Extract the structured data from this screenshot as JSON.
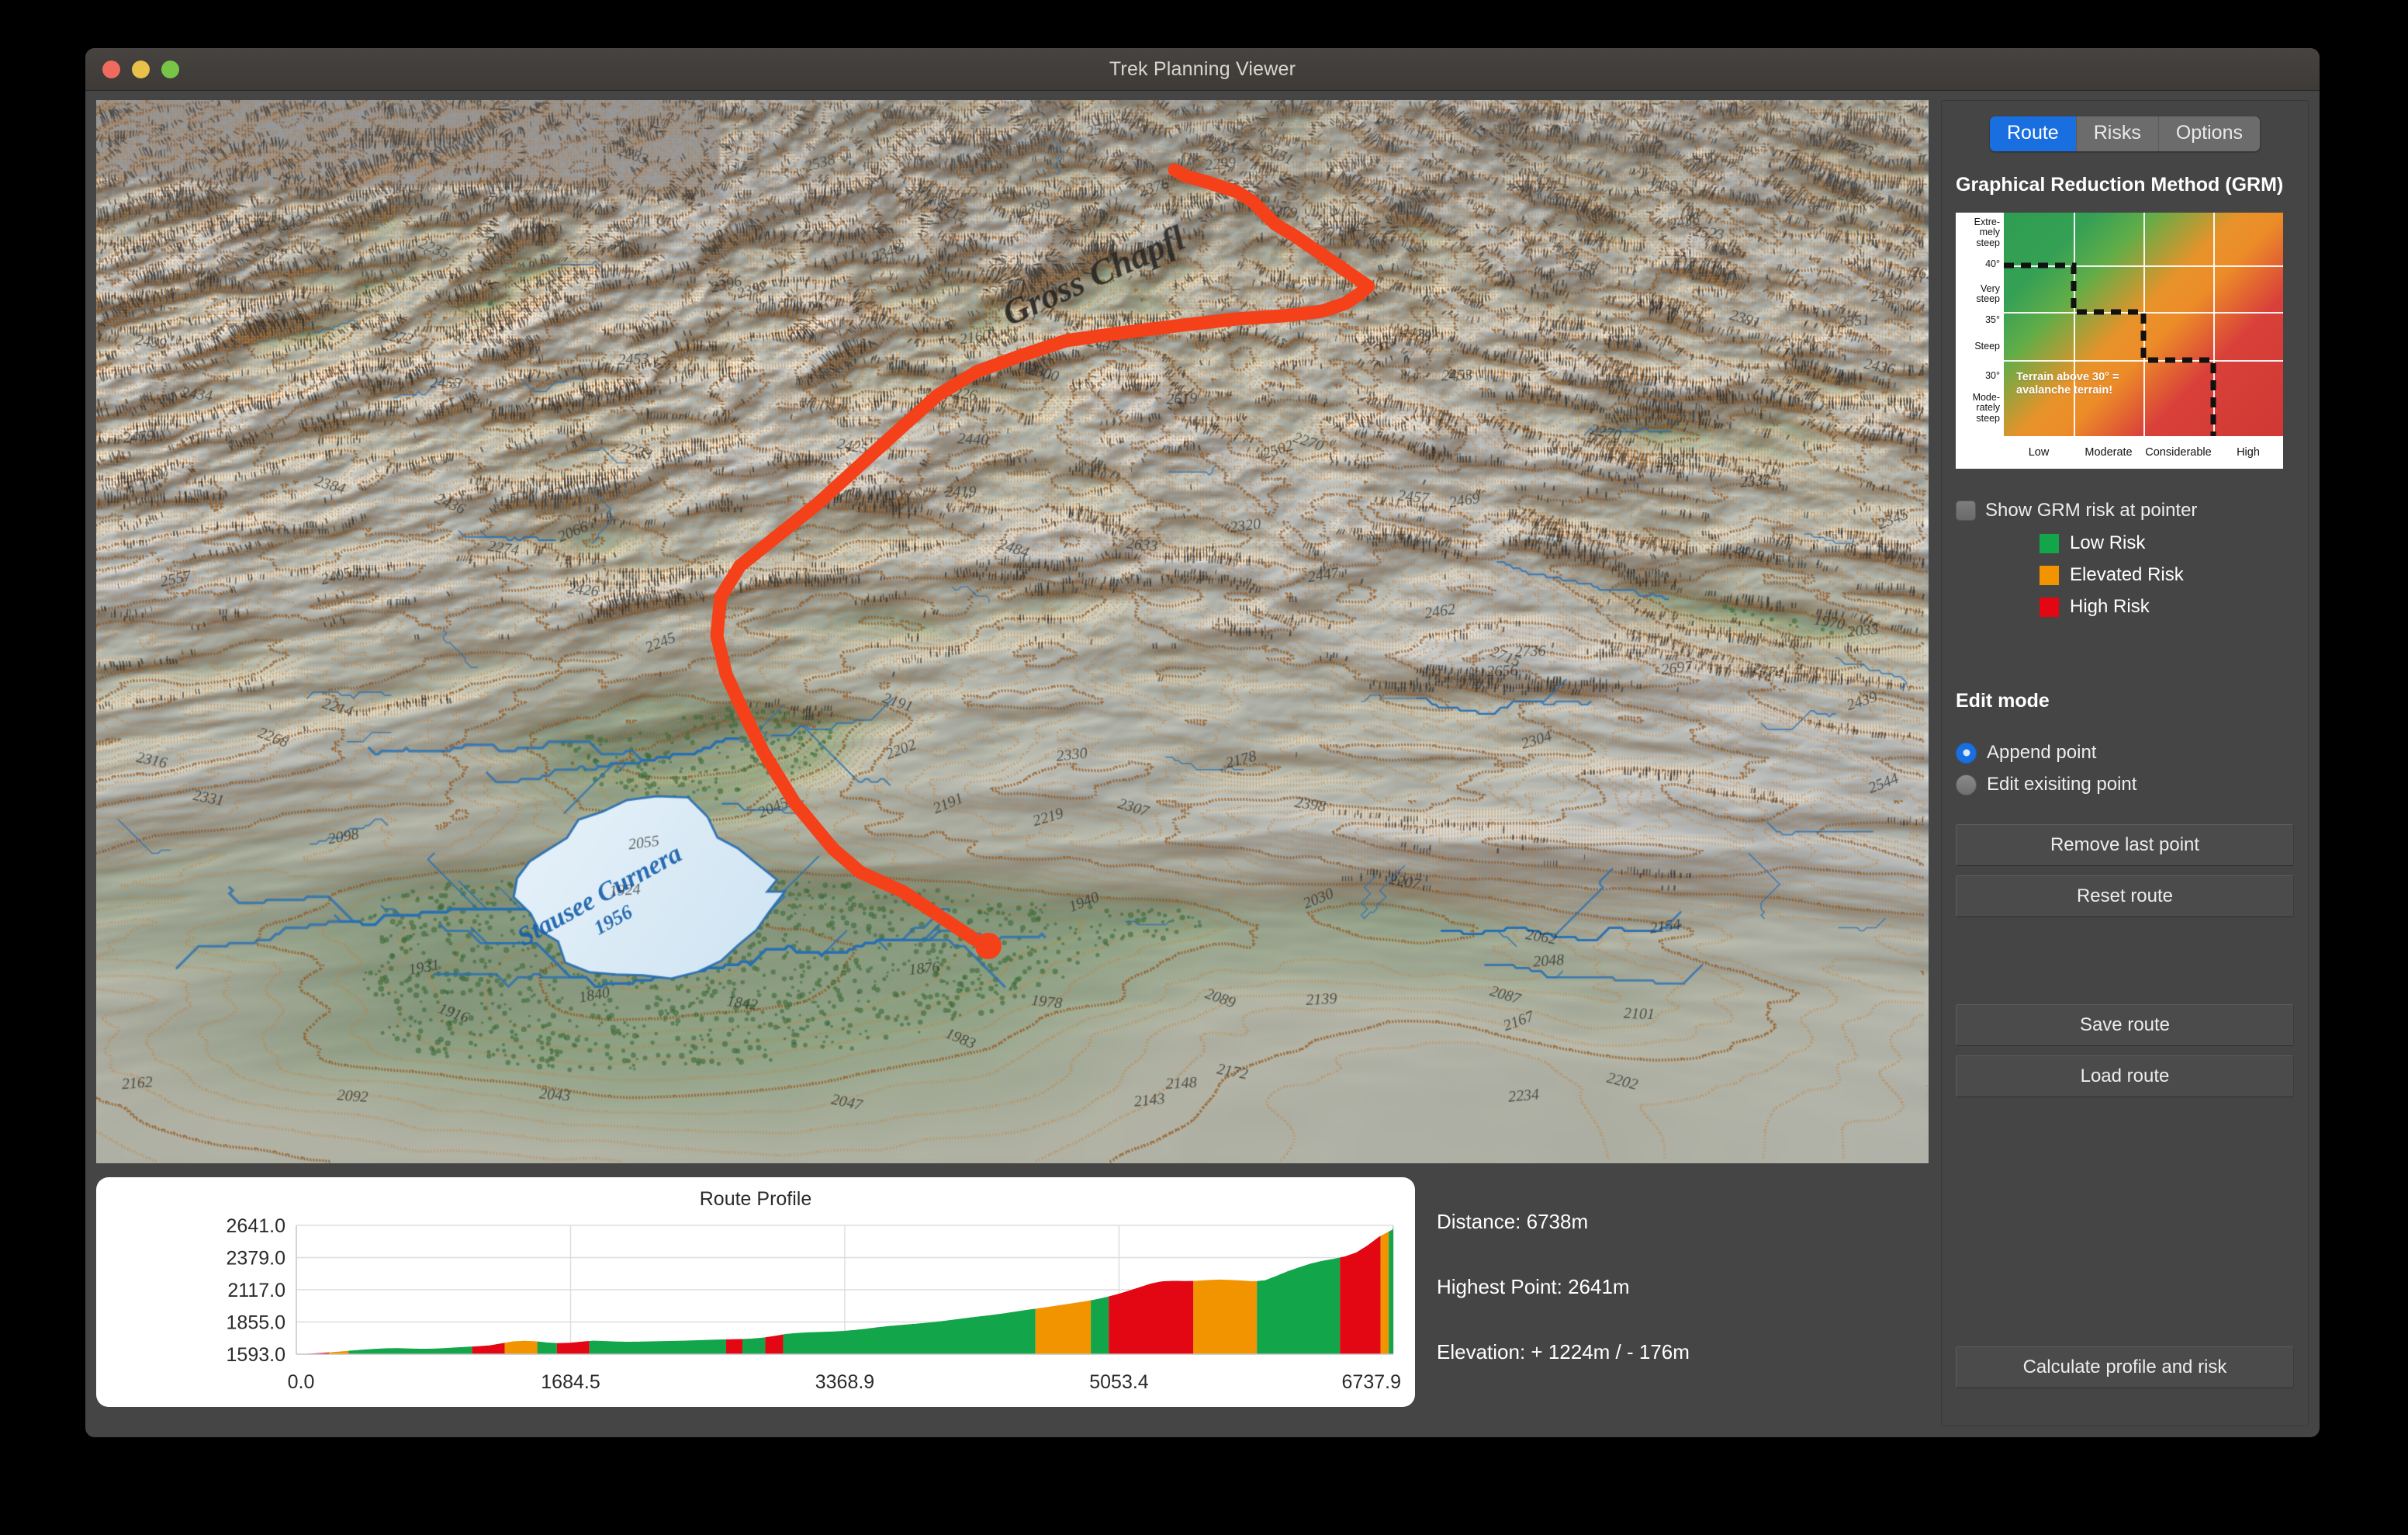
{
  "window": {
    "title": "Trek Planning Viewer",
    "traffic_lights": [
      "close",
      "minimize",
      "maximize"
    ]
  },
  "sidebar": {
    "tabs": [
      {
        "label": "Route",
        "active": true
      },
      {
        "label": "Risks",
        "active": false
      },
      {
        "label": "Options",
        "active": false
      }
    ],
    "grm_heading": "Graphical Reduction Method (GRM)",
    "grm_chart": {
      "y_labels": [
        "Extre-\nmely\nsteep",
        "40°",
        "Very\nsteep",
        "35°",
        "Steep",
        "30°",
        "Mode-\nrately\nsteep"
      ],
      "x_labels": [
        "Low",
        "Moderate",
        "Considerable",
        "High"
      ],
      "note": "Terrain above 30° =\navalanche terrain!"
    },
    "pointer_toggle": {
      "label": "Show GRM risk at pointer",
      "checked": false
    },
    "risk_legend": [
      {
        "label": "Low Risk",
        "color": "#13a54a"
      },
      {
        "label": "Elevated Risk",
        "color": "#f29400"
      },
      {
        "label": "High Risk",
        "color": "#e30613"
      }
    ],
    "edit_mode": {
      "heading": "Edit mode",
      "options": [
        {
          "label": "Append point",
          "selected": true
        },
        {
          "label": "Edit exisiting point",
          "selected": false
        }
      ]
    },
    "buttons": {
      "remove_last_point": "Remove last point",
      "reset_route": "Reset route",
      "save_route": "Save route",
      "load_route": "Load route",
      "calculate": "Calculate profile and risk"
    }
  },
  "map": {
    "background_color": "#9b9b9b",
    "route_color": "#f5411a",
    "visible_labels": [
      "Gross Chapfl",
      "Stausee Curnera 1956"
    ]
  },
  "stats": {
    "distance": "Distance: 6738m",
    "highest_point": "Highest Point:  2641m",
    "elevation": "Elevation: + 1224m / - 176m"
  },
  "chart_data": {
    "type": "area",
    "title": "Route Profile",
    "xlabel": "",
    "ylabel": "",
    "xlim": [
      0.0,
      6737.9
    ],
    "ylim": [
      1593.0,
      2641.0
    ],
    "grid": true,
    "legend": "none",
    "x_ticks": [
      0.0,
      1684.5,
      3368.9,
      5053.4,
      6737.9
    ],
    "x_tick_labels": [
      "0.0",
      "1684.5",
      "3368.9",
      "5053.4",
      "6737.9"
    ],
    "y_ticks": [
      1593.0,
      1855.0,
      2117.0,
      2379.0,
      2641.0
    ],
    "y_tick_labels": [
      "1593.0",
      "1855.0",
      "2117.0",
      "2379.0",
      "2641.0"
    ],
    "risk_colors": {
      "low": "#13a54a",
      "elevated": "#f29400",
      "high": "#e30613"
    },
    "x": [
      0,
      70,
      140,
      210,
      280,
      350,
      420,
      490,
      560,
      630,
      700,
      770,
      840,
      910,
      980,
      1050,
      1120,
      1190,
      1260,
      1330,
      1400,
      1470,
      1540,
      1610,
      1680,
      1750,
      1820,
      1890,
      1960,
      2030,
      2100,
      2170,
      2240,
      2310,
      2380,
      2450,
      2520,
      2590,
      2660,
      2730,
      2800,
      2870,
      2940,
      3010,
      3080,
      3150,
      3220,
      3290,
      3360,
      3430,
      3500,
      3570,
      3640,
      3710,
      3780,
      3850,
      3920,
      3990,
      4060,
      4130,
      4200,
      4270,
      4340,
      4410,
      4480,
      4550,
      4620,
      4690,
      4760,
      4830,
      4900,
      4970,
      5040,
      5110,
      5180,
      5250,
      5320,
      5390,
      5460,
      5530,
      5600,
      5670,
      5740,
      5810,
      5880,
      5950,
      6020,
      6090,
      6160,
      6230,
      6300,
      6370,
      6440,
      6510,
      6580,
      6650,
      6737.9
    ],
    "elevation": [
      1593,
      1597,
      1602,
      1608,
      1616,
      1624,
      1631,
      1637,
      1641,
      1642,
      1639,
      1637,
      1638,
      1642,
      1648,
      1653,
      1658,
      1665,
      1681,
      1697,
      1702,
      1698,
      1688,
      1683,
      1686,
      1695,
      1703,
      1700,
      1696,
      1694,
      1695,
      1697,
      1699,
      1701,
      1703,
      1706,
      1709,
      1712,
      1714,
      1716,
      1720,
      1728,
      1742,
      1758,
      1766,
      1771,
      1774,
      1777,
      1782,
      1790,
      1800,
      1812,
      1822,
      1830,
      1838,
      1846,
      1855,
      1866,
      1878,
      1890,
      1901,
      1912,
      1924,
      1938,
      1952,
      1965,
      1978,
      1992,
      2006,
      2020,
      2036,
      2056,
      2080,
      2108,
      2138,
      2168,
      2186,
      2190,
      2188,
      2190,
      2196,
      2200,
      2197,
      2192,
      2186,
      2194,
      2230,
      2268,
      2300,
      2330,
      2352,
      2368,
      2388,
      2420,
      2478,
      2548,
      2610,
      2636,
      2641
    ],
    "risk_segments": [
      {
        "start": 0,
        "end": 200,
        "risk": "high"
      },
      {
        "start": 200,
        "end": 320,
        "risk": "elevated"
      },
      {
        "start": 320,
        "end": 1080,
        "risk": "low"
      },
      {
        "start": 1080,
        "end": 1280,
        "risk": "high"
      },
      {
        "start": 1280,
        "end": 1480,
        "risk": "elevated"
      },
      {
        "start": 1480,
        "end": 1600,
        "risk": "low"
      },
      {
        "start": 1600,
        "end": 1800,
        "risk": "high"
      },
      {
        "start": 1800,
        "end": 2640,
        "risk": "low"
      },
      {
        "start": 2640,
        "end": 2740,
        "risk": "high"
      },
      {
        "start": 2740,
        "end": 2880,
        "risk": "low"
      },
      {
        "start": 2880,
        "end": 2990,
        "risk": "high"
      },
      {
        "start": 2990,
        "end": 4540,
        "risk": "low"
      },
      {
        "start": 4540,
        "end": 4880,
        "risk": "elevated"
      },
      {
        "start": 4880,
        "end": 4990,
        "risk": "low"
      },
      {
        "start": 4990,
        "end": 5510,
        "risk": "high"
      },
      {
        "start": 5510,
        "end": 5900,
        "risk": "elevated"
      },
      {
        "start": 5900,
        "end": 6410,
        "risk": "low"
      },
      {
        "start": 6410,
        "end": 6660,
        "risk": "high"
      },
      {
        "start": 6660,
        "end": 6710,
        "risk": "elevated"
      },
      {
        "start": 6710,
        "end": 6737.9,
        "risk": "low"
      }
    ]
  }
}
